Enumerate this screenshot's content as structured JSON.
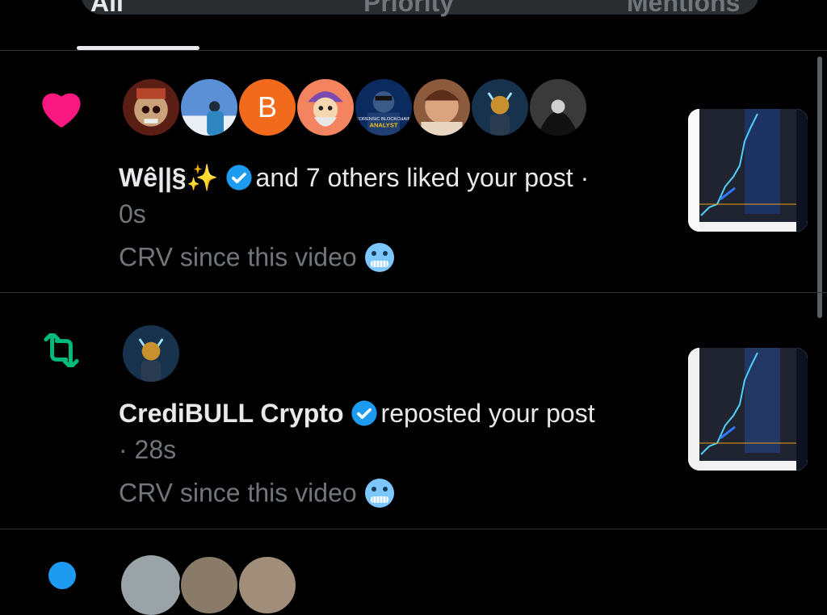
{
  "tabs": {
    "all": "All",
    "priority": "Priority",
    "mentions": "Mentions"
  },
  "notifications": [
    {
      "type_icon": "heart-icon",
      "actor_name": "Wê||§✨",
      "verified": true,
      "action_text": "and 7 others liked your post ·",
      "time": "0s",
      "post_text": "CRV since this video",
      "post_emoji": "cold-face-emoji",
      "avatar_letter": "B",
      "avatar_badge_text": "FORENSIC BLOCKCHAIN",
      "avatar_badge_sub": "ANALYST"
    },
    {
      "type_icon": "repost-icon",
      "actor_name": "CrediBULL Crypto",
      "verified": true,
      "action_text": "reposted your post",
      "time": "· 28s",
      "post_text": "CRV since this video",
      "post_emoji": "cold-face-emoji"
    }
  ],
  "colors": {
    "like": "#f91880",
    "repost": "#00ba7c",
    "verified": "#1d9bf0",
    "muted": "#71767b"
  }
}
